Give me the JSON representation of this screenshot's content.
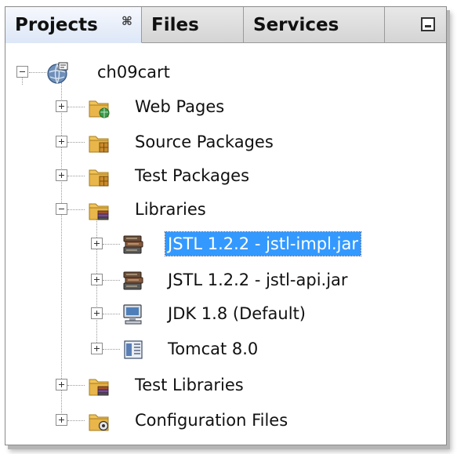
{
  "tabs": {
    "projects": "Projects",
    "projects_close": "⌘",
    "files": "Files",
    "services": "Services"
  },
  "tree": {
    "root": "ch09cart",
    "web_pages": "Web Pages",
    "source_packages": "Source Packages",
    "test_packages": "Test Packages",
    "libraries": "Libraries",
    "lib_jstl_impl": "JSTL 1.2.2 - jstl-impl.jar",
    "lib_jstl_api": "JSTL 1.2.2 - jstl-api.jar",
    "lib_jdk": "JDK 1.8 (Default)",
    "lib_tomcat": "Tomcat 8.0",
    "test_libraries": "Test Libraries",
    "configuration_files": "Configuration Files"
  },
  "selected_item": "JSTL 1.2.2 - jstl-impl.jar",
  "colors": {
    "selection": "#3399ff",
    "folder": "#e8b64a",
    "active_tab": "#dde7f7"
  },
  "icons": {
    "root": "project-globe-icon",
    "folder": "folder-icon",
    "library": "library-books-icon",
    "jdk": "computer-icon",
    "server": "server-icon"
  }
}
